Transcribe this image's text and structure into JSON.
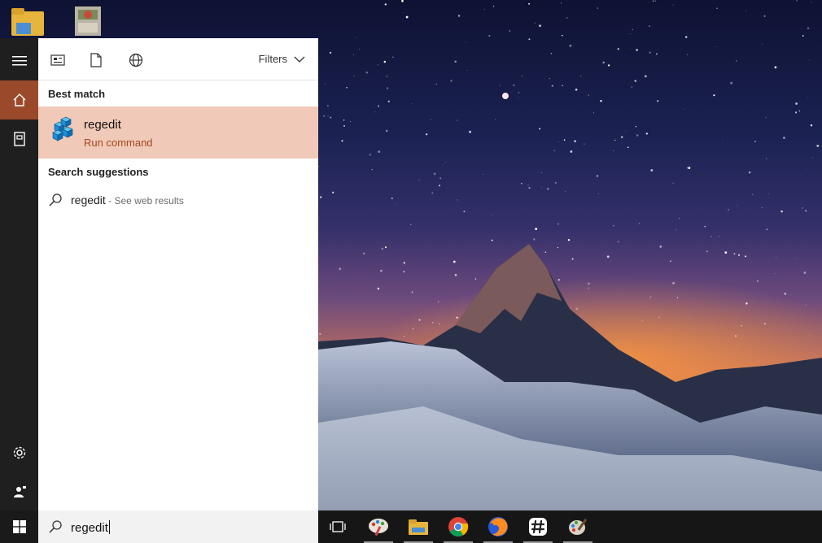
{
  "panel": {
    "toolbar": {
      "icons": [
        "apps-icon",
        "document-icon",
        "globe-icon"
      ],
      "filters_label": "Filters"
    },
    "best_match": {
      "title": "Best match",
      "item": {
        "name": "regedit",
        "subtitle": "Run command",
        "icon": "regedit-icon"
      }
    },
    "suggestions": {
      "title": "Search suggestions",
      "items": [
        {
          "text": "regedit",
          "hint": " - See web results"
        }
      ]
    }
  },
  "rail": {
    "items": [
      "hamburger-icon",
      "home-icon",
      "notebook-icon",
      "settings-icon",
      "feedback-icon"
    ],
    "active": "home-icon"
  },
  "search": {
    "value": "regedit"
  },
  "taskbar": {
    "apps": [
      "task-view-icon",
      "paint-icon",
      "file-explorer-icon",
      "chrome-icon",
      "firefox-icon",
      "slack-icon",
      "paint-brush-icon"
    ]
  },
  "colors": {
    "accent": "#9a4a2a",
    "best_match_bg": "#f1c9b8",
    "subtitle": "#a3481f",
    "rail": "#1f1f1f",
    "taskbar": "#161616"
  }
}
